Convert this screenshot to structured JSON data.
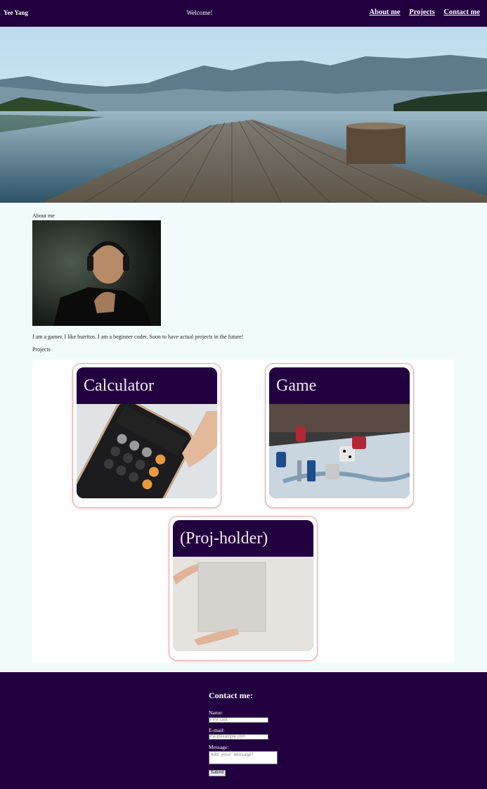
{
  "nav": {
    "brand": "Yee Yang",
    "welcome": "Welcome!",
    "links": [
      "About me",
      "Projects",
      "Contact me"
    ]
  },
  "about": {
    "title": "About me",
    "text": "I am a gamer. I like burritos. I am a beginner coder. Soon to have actual projects in the future!"
  },
  "projects": {
    "title": "Projects",
    "cards": [
      {
        "title": "Calculator"
      },
      {
        "title": "Game"
      },
      {
        "title": "(Proj-holder)"
      }
    ]
  },
  "contact": {
    "title": "Contact me:",
    "name_label": "Name:",
    "name_placeholder": "First Last",
    "email_label": "E-mail:",
    "email_placeholder": "me@example.com",
    "message_label": "Message:",
    "message_placeholder": "Add your message!",
    "submit_label": "Submit"
  },
  "colors": {
    "nav_bg": "#220040",
    "page_bg": "#f1fbfc",
    "card_border": "#f0a0a0"
  }
}
